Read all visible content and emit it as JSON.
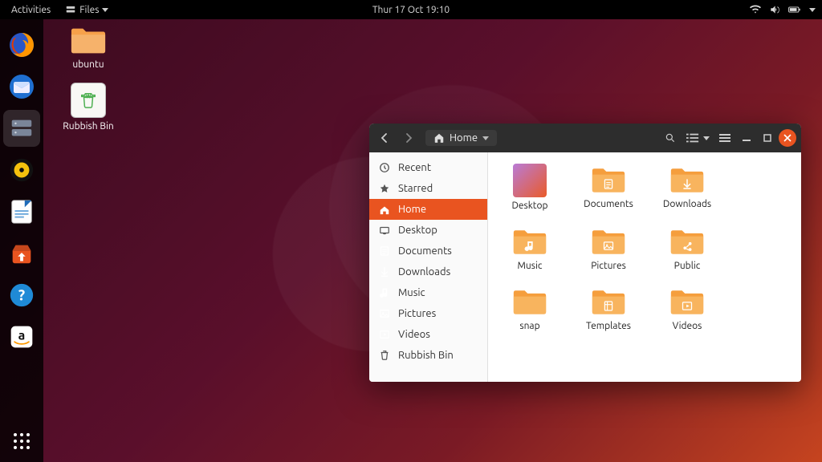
{
  "top_panel": {
    "activities": "Activities",
    "app_menu": "Files",
    "clock": "Thur 17 Oct 19:10"
  },
  "desktop": {
    "icons": [
      {
        "name": "ubuntu",
        "kind": "folder"
      },
      {
        "name": "Rubbish Bin",
        "kind": "trash"
      }
    ]
  },
  "dock": {
    "items": [
      {
        "name": "firefox"
      },
      {
        "name": "thunderbird"
      },
      {
        "name": "files",
        "active": true
      },
      {
        "name": "rhythmbox"
      },
      {
        "name": "libreoffice-writer"
      },
      {
        "name": "ubuntu-software"
      },
      {
        "name": "help"
      },
      {
        "name": "amazon"
      }
    ]
  },
  "files_window": {
    "path_label": "Home",
    "sidebar": [
      {
        "icon": "clock",
        "label": "Recent"
      },
      {
        "icon": "star",
        "label": "Starred"
      },
      {
        "icon": "home",
        "label": "Home",
        "selected": true
      },
      {
        "icon": "desktop",
        "label": "Desktop"
      },
      {
        "icon": "doc",
        "label": "Documents"
      },
      {
        "icon": "download",
        "label": "Downloads"
      },
      {
        "icon": "music",
        "label": "Music"
      },
      {
        "icon": "picture",
        "label": "Pictures"
      },
      {
        "icon": "video",
        "label": "Videos"
      },
      {
        "icon": "trash",
        "label": "Rubbish Bin"
      }
    ],
    "items": [
      {
        "label": "Desktop",
        "kind": "desktop"
      },
      {
        "label": "Documents",
        "kind": "folder",
        "glyph": "doc"
      },
      {
        "label": "Downloads",
        "kind": "folder",
        "glyph": "download"
      },
      {
        "label": "Music",
        "kind": "folder",
        "glyph": "music"
      },
      {
        "label": "Pictures",
        "kind": "folder",
        "glyph": "picture"
      },
      {
        "label": "Public",
        "kind": "folder",
        "glyph": "share"
      },
      {
        "label": "snap",
        "kind": "folder",
        "glyph": ""
      },
      {
        "label": "Templates",
        "kind": "folder",
        "glyph": "template"
      },
      {
        "label": "Videos",
        "kind": "folder",
        "glyph": "video"
      }
    ]
  }
}
